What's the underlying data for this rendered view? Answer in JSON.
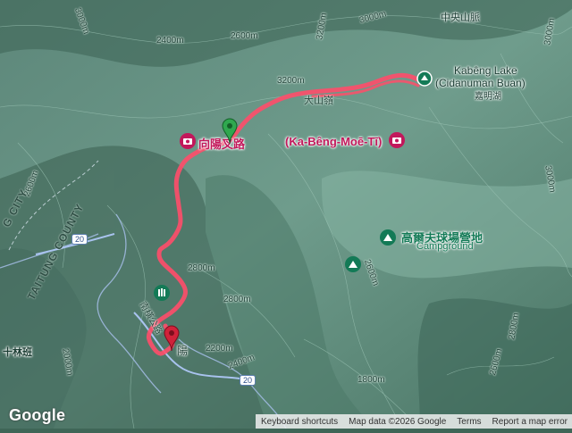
{
  "labels": {
    "central_range": "中央山脈",
    "lake_en": "Kabêng Lake",
    "lake_alt": "(Cidanuman Buan)",
    "lake_zh": "嘉明湖",
    "junction": "向陽叉路",
    "ka_beng": "(Ka-Bêng-Moē-Tī)",
    "campsite_zh": "高爾夫球場營地",
    "campground": "Campground",
    "ridge_label": "大山嶺",
    "trail_road": "南橫公路",
    "county_city": "G CITY",
    "county": "TAITUNG COUNTY",
    "village": "十林班",
    "yang": "陽",
    "route_20a": "20",
    "route_20b": "20"
  },
  "contours": [
    "3000m",
    "3200m",
    "2600m",
    "3000m",
    "2400m",
    "2600m",
    "2800m",
    "3000m",
    "2800m",
    "2400m",
    "2000m",
    "2200m",
    "1800m",
    "2600m",
    "2800m",
    "2600m",
    "3000m",
    "3200m"
  ],
  "attribution": {
    "logo": "Google",
    "shortcuts": "Keyboard shortcuts",
    "map_data": "Map data ©2026 Google",
    "terms": "Terms",
    "report": "Report a map error"
  },
  "colors": {
    "track": "#ff4d6a",
    "start_pin": "#2fa84f",
    "end_pin": "#d0223a",
    "poi_pink": "#c2185b",
    "poi_green": "#137a56",
    "terrain": "#4f7a6a",
    "road": "#8fb3e6"
  },
  "icons": [
    "camera-icon",
    "camera-icon",
    "campsite-icon",
    "campsite-icon",
    "hiker-icon",
    "start-pin-icon",
    "end-pin-icon",
    "lake-pin-icon"
  ]
}
